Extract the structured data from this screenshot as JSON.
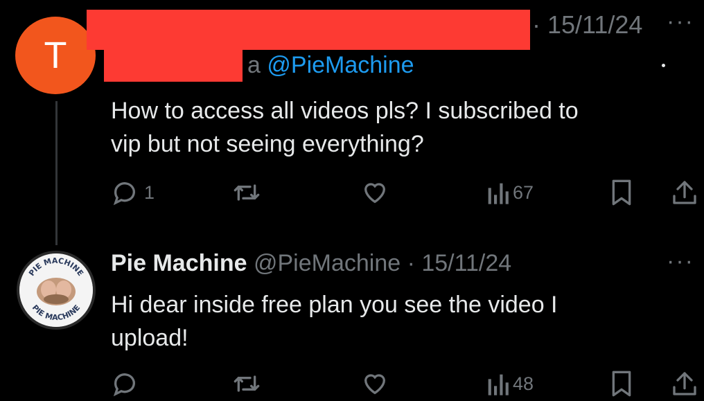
{
  "tweet1": {
    "avatar_letter": "T",
    "timestamp": "· 15/11/24",
    "reply_prefix": "a",
    "reply_handle": "@PieMachine",
    "text_line1": "How to access all videos pls? I subscribed to",
    "text_line2": "vip but not seeing everything?",
    "reply_count": "1",
    "view_count": "67"
  },
  "tweet2": {
    "avatar_text_top": "PIE MACHINE",
    "avatar_text_bottom": "PIE MACHINE",
    "name": "Pie Machine",
    "handle": "@PieMachine",
    "timestamp": "· 15/11/24",
    "text_line1": "Hi dear inside free plan you see the video I",
    "text_line2": "upload!",
    "view_count": "48"
  },
  "more_glyph": "···",
  "colors": {
    "background": "#000000",
    "accent": "#1d9bf0",
    "muted": "#71767b",
    "redaction": "#fd3a33",
    "avatar": "#f2561d"
  },
  "icons": [
    "reply-icon",
    "retweet-icon",
    "like-icon",
    "views-icon",
    "bookmark-icon",
    "share-icon",
    "more-icon"
  ]
}
